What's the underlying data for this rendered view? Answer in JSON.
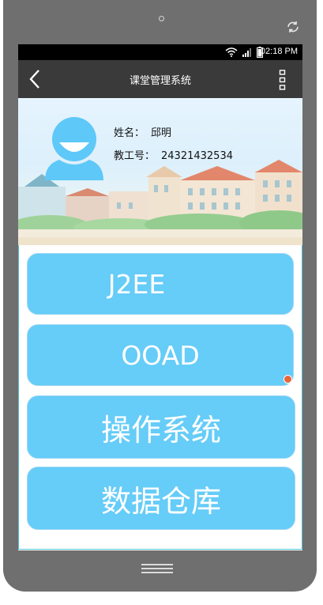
{
  "status_bar": {
    "time": "02:18 PM"
  },
  "app_bar": {
    "title": "课堂管理系统"
  },
  "profile": {
    "name_label": "姓名：",
    "name_value": "邱明",
    "id_label": "教工号：",
    "id_value": "24321432534"
  },
  "courses": [
    {
      "label": "J2EE"
    },
    {
      "label": "OOAD"
    },
    {
      "label": "操作系统"
    },
    {
      "label": "数据仓库"
    }
  ],
  "colors": {
    "course_button": "#66ccf8",
    "app_bar": "#3a3a3a",
    "avatar": "#5ec8f8"
  }
}
